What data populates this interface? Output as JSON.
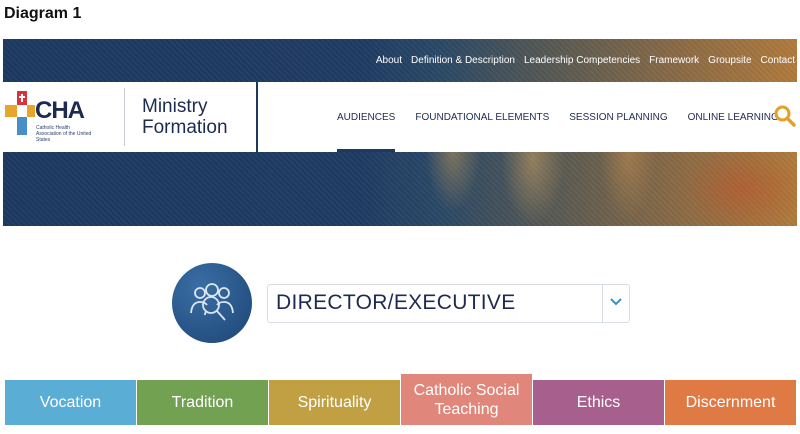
{
  "diagram_label": "Diagram 1",
  "top_nav": [
    "About",
    "Definition & Description",
    "Leadership Competencies",
    "Framework",
    "Groupsite",
    "Contact"
  ],
  "logo": {
    "text": "CHA",
    "subtitle": "Catholic Health Association of the United States"
  },
  "brand": {
    "line1": "Ministry",
    "line2": "Formation"
  },
  "main_nav": [
    "AUDIENCES",
    "FOUNDATIONAL ELEMENTS",
    "SESSION PLANNING",
    "ONLINE LEARNING"
  ],
  "audience_select": {
    "value": "DIRECTOR/EXECUTIVE"
  },
  "categories": [
    {
      "label": "Vocation",
      "color": "#5aaed6"
    },
    {
      "label": "Tradition",
      "color": "#73a152"
    },
    {
      "label": "Spirituality",
      "color": "#c0a043"
    },
    {
      "label": "Catholic Social Teaching",
      "color": "#e0867a"
    },
    {
      "label": "Ethics",
      "color": "#a75f8e"
    },
    {
      "label": "Discernment",
      "color": "#e07a45"
    }
  ],
  "colors": {
    "navy": "#1d3960",
    "search": "#e5a02a",
    "chevron": "#3a8fc4"
  }
}
